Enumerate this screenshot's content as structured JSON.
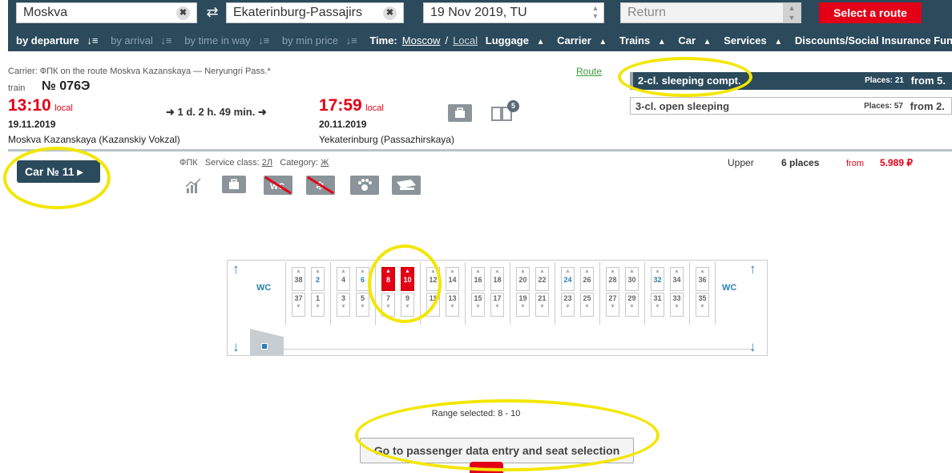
{
  "search": {
    "from_value": "Moskva",
    "to_value": "Ekaterinburg-Passajirs",
    "date_value": "19 Nov 2019, TU",
    "return_placeholder": "Return",
    "select_route_label": "Select a route",
    "clear_glyph": "✖",
    "swap_glyph": "⇄"
  },
  "sortbar": {
    "by_departure": "by departure",
    "by_arrival": "by arrival",
    "by_time_in_way": "by time in way",
    "by_min_price": "by min price",
    "time_label": "Time:",
    "time_moscow": "Moscow",
    "time_sep": "/",
    "time_local": "Local",
    "luggage": "Luggage",
    "carrier": "Carrier",
    "trains": "Trains",
    "car": "Car",
    "services": "Services",
    "discounts": "Discounts/Social Insurance Fund",
    "sort_glyph": "↓≡",
    "tri_glyph": "▲"
  },
  "train": {
    "carrier_line": "Carrier: ФПК   on the route Moskva Kazanskaya — Neryungri Pass.*",
    "route_link": "Route",
    "train_word": "train",
    "number": "№ 076Э",
    "dep_time": "13:10",
    "dep_local": "local",
    "dep_date": "19.11.2019",
    "dep_station": "Moskva Kazanskaya (Kazanskiy Vokzal)",
    "duration": "➜ 1 d. 2 h. 49 min. ➜",
    "arr_time": "17:59",
    "arr_local": "local",
    "arr_date": "20.11.2019",
    "arr_station": "Yekaterinburg (Passazhirskaya)",
    "badge_count": "5"
  },
  "classes": [
    {
      "label": "2-cl. sleeping compt.",
      "places": "Places: 21",
      "from": "from   5."
    },
    {
      "label": "3-cl. open sleeping",
      "places": "Places: 57",
      "from": "from   2."
    }
  ],
  "car": {
    "button_label": "Car № 11 ▸",
    "carrier": "ФПК",
    "service_class_label": "Service class:",
    "service_class_value": "2Л",
    "category_label": "Category:",
    "category_value": "Ж",
    "upper_label": "Upper",
    "places": "6 places",
    "from_word": "from",
    "price": "5.989 ₽"
  },
  "scheme": {
    "wc_label": "WC",
    "up_arrow": "↑",
    "down_arrow": "↓",
    "seat_up_arrow": "▲",
    "seat_down_arrow": "▼",
    "upper_seats": [
      "38",
      "2",
      "4",
      "6",
      "8",
      "10",
      "12",
      "14",
      "16",
      "18",
      "20",
      "22",
      "24",
      "26",
      "28",
      "30",
      "32",
      "34",
      "36"
    ],
    "lower_seats": [
      "37",
      "1",
      "3",
      "5",
      "7",
      "9",
      "11",
      "13",
      "15",
      "17",
      "19",
      "21",
      "23",
      "25",
      "27",
      "29",
      "31",
      "33",
      "35"
    ]
  },
  "footer": {
    "range_text": "Range selected: 8 - 10",
    "go_button": "Go to passenger data entry and seat selection"
  }
}
